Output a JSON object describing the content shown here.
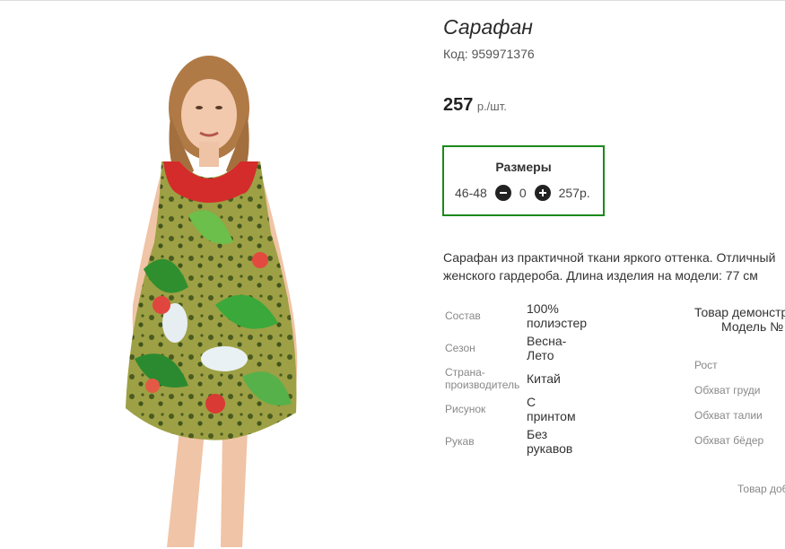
{
  "product": {
    "title": "Сарафан",
    "code_label": "Код:",
    "code_value": "959971376",
    "price_value": "257",
    "price_unit": "р./шт.",
    "image_icon": "dress-photo"
  },
  "sizes": {
    "title": "Размеры",
    "size": "46-48",
    "minus_icon": "minus-circle-icon",
    "quantity": "0",
    "plus_icon": "plus-circle-icon",
    "price": "257р."
  },
  "description": {
    "line1": "Сарафан из практичной ткани яркого оттенка. Отличный",
    "line2": "женского гардероба. Длина изделия на модели: 77 см"
  },
  "specs": [
    {
      "label": "Состав",
      "value": "100% полиэстер"
    },
    {
      "label": "Сезон",
      "value": "Весна-Лето"
    },
    {
      "label": "Страна-производитель",
      "value": "Китай"
    },
    {
      "label": "Рисунок",
      "value": "С принтом"
    },
    {
      "label": "Рукав",
      "value": "Без рукавов"
    }
  ],
  "model": {
    "title": "Товар демонстр",
    "subtitle": "Модель №",
    "measures": [
      "Рост",
      "Обхват груди",
      "Обхват талии",
      "Обхват бёдер"
    ]
  },
  "footer_note": "Товар до6"
}
